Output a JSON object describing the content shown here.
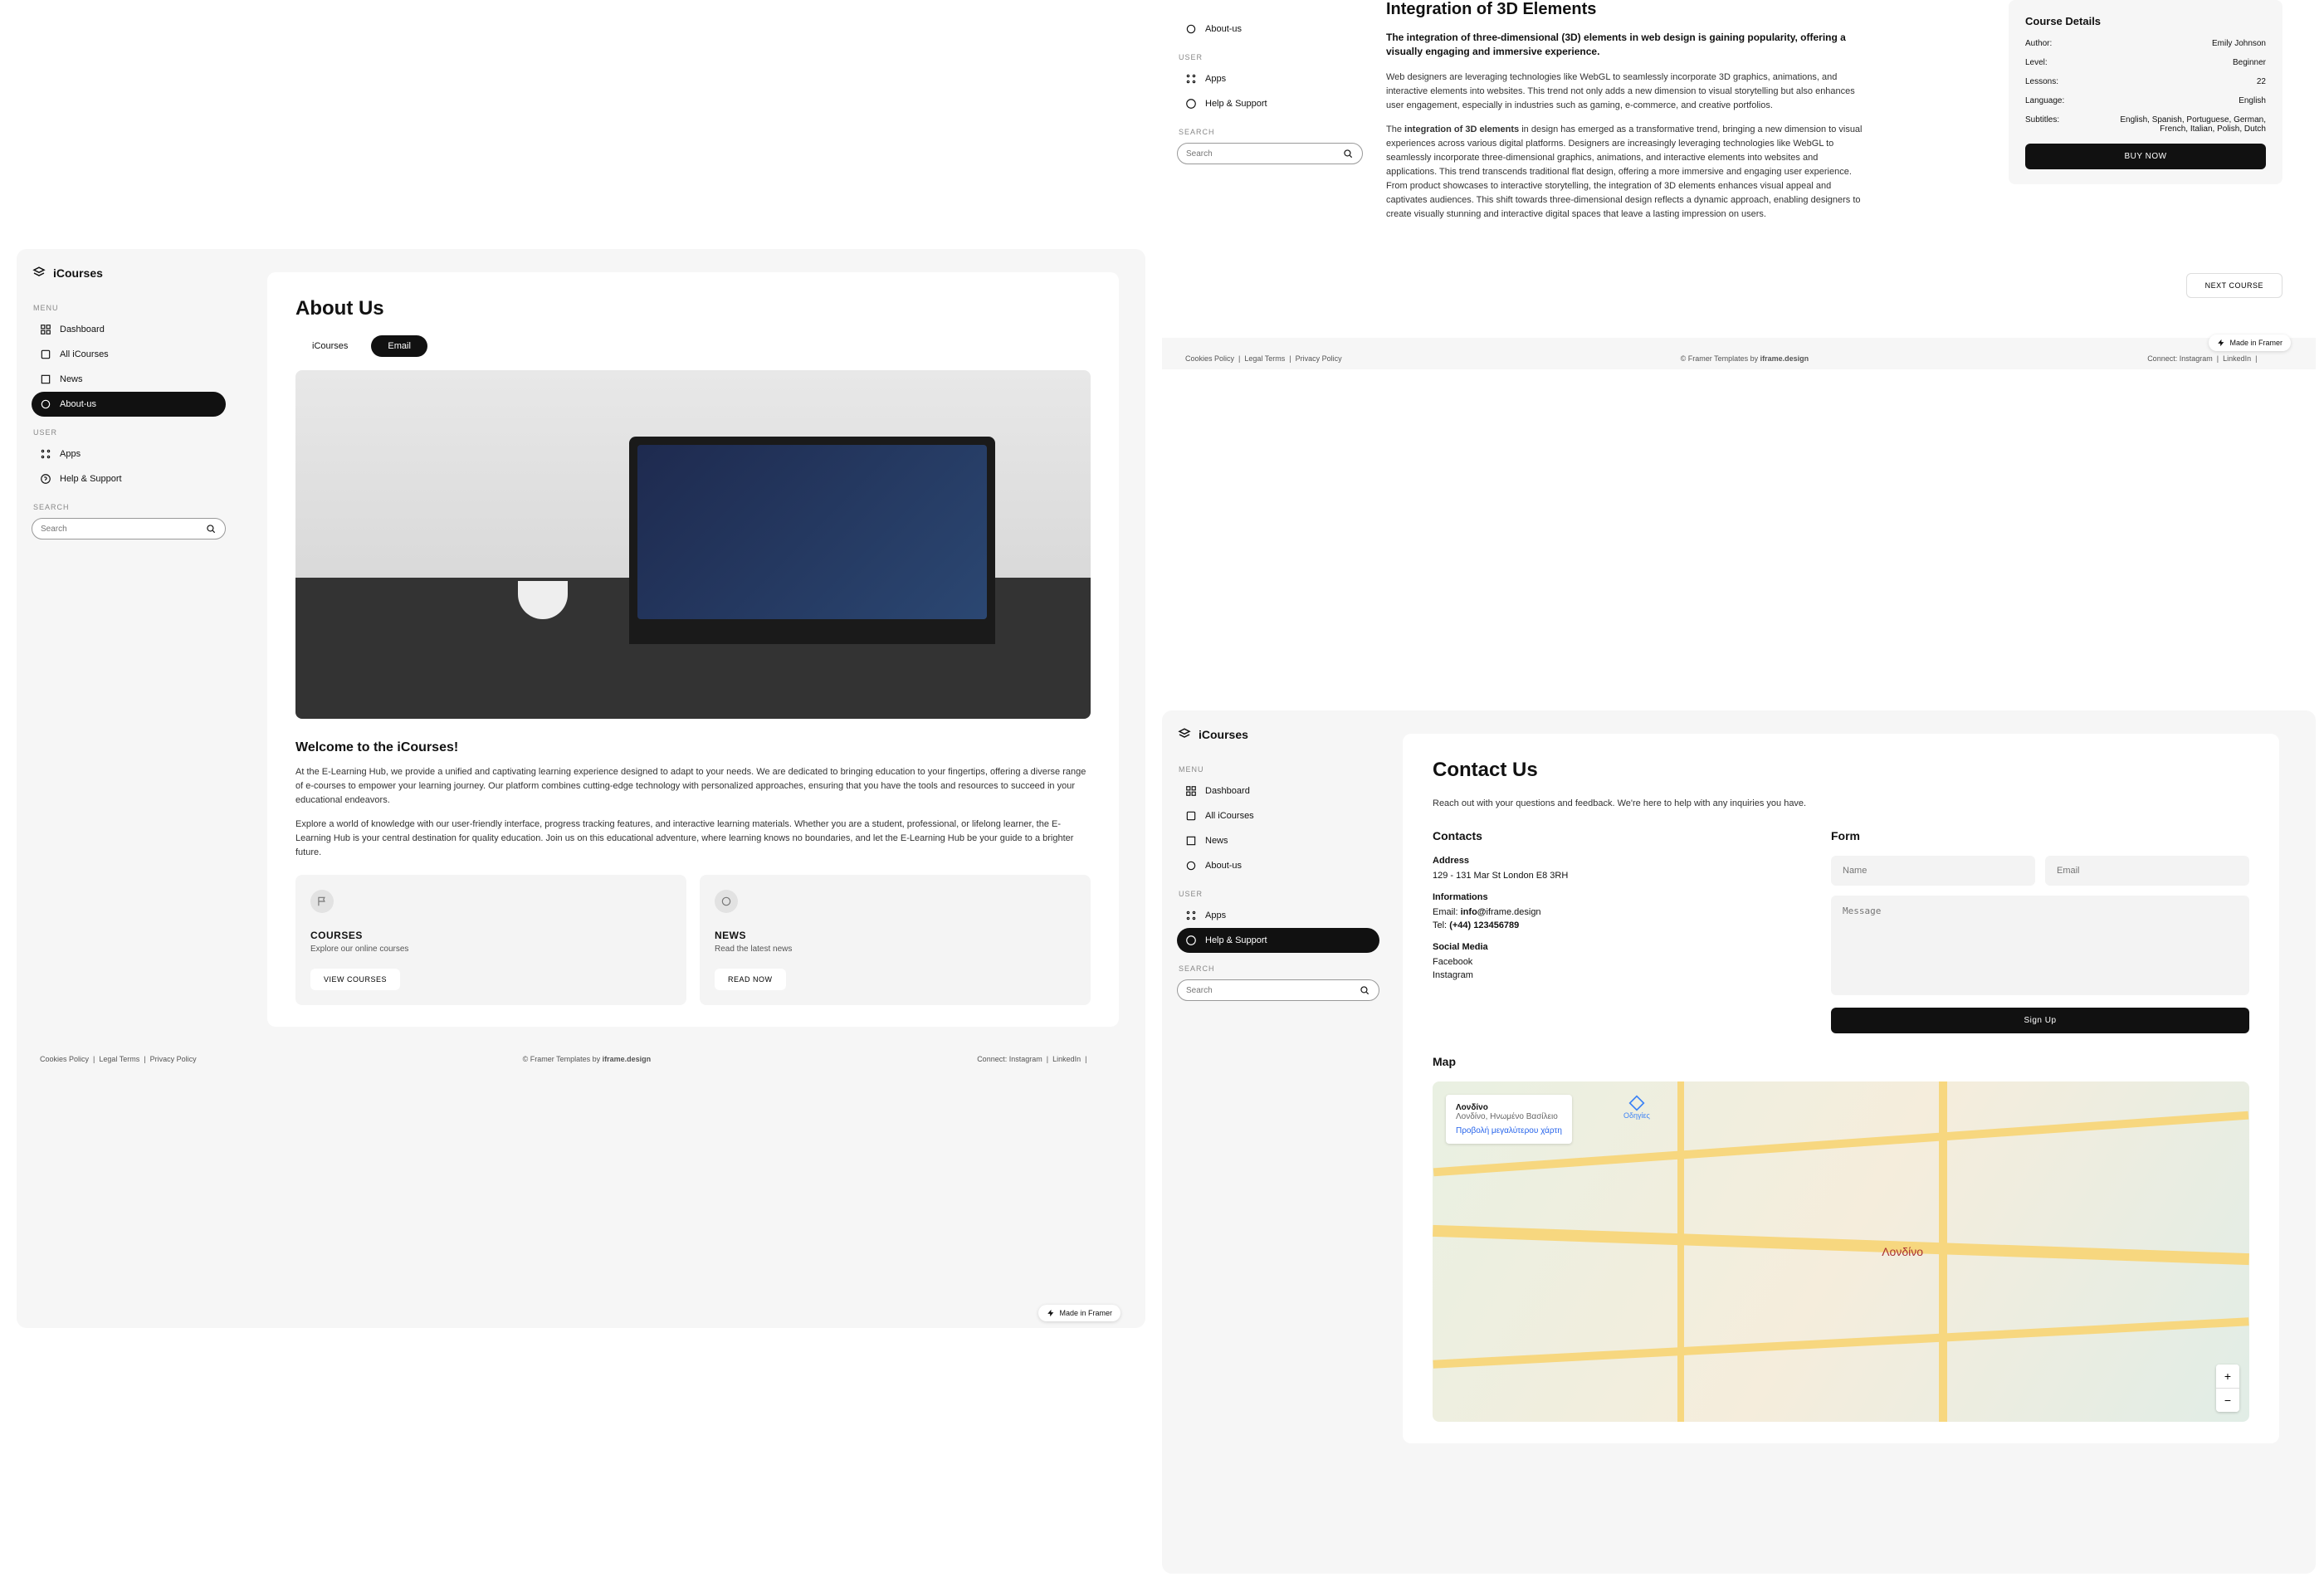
{
  "brand": "iCourses",
  "sidebar": {
    "menu_label": "MENU",
    "user_label": "USER",
    "search_label": "SEARCH",
    "items": {
      "dashboard": "Dashboard",
      "all": "All iCourses",
      "news": "News",
      "about": "About-us",
      "apps": "Apps",
      "help": "Help & Support"
    },
    "search_placeholder": "Search"
  },
  "about": {
    "title": "About Us",
    "tabs": {
      "icourses": "iCourses",
      "email": "Email"
    },
    "welcome": "Welcome to the iCourses!",
    "p1": "At the E-Learning Hub, we provide a unified and captivating learning experience designed to adapt to your needs. We are dedicated to bringing education to your fingertips, offering a diverse range of e-courses to empower your learning journey. Our platform combines cutting-edge technology with personalized approaches, ensuring that you have the tools and resources to succeed in your educational endeavors.",
    "p2": "Explore a world of knowledge with our user-friendly interface, progress tracking features, and interactive learning materials. Whether you are a student, professional, or lifelong learner, the E-Learning Hub is your central destination for quality education. Join us on this educational adventure, where learning knows no boundaries, and let the E-Learning Hub be your guide to a brighter future.",
    "card_courses": {
      "title": "COURSES",
      "desc": "Explore our online courses",
      "btn": "VIEW COURSES"
    },
    "card_news": {
      "title": "NEWS",
      "desc": "Read the latest news",
      "btn": "READ NOW"
    }
  },
  "article": {
    "title": "Integration of 3D Elements",
    "sub": "The integration of three-dimensional (3D) elements in web design is gaining popularity, offering a visually engaging and immersive experience.",
    "p1": "Web designers are leveraging technologies like WebGL to seamlessly incorporate 3D graphics, animations, and interactive elements into websites. This trend not only adds a new dimension to visual storytelling but also enhances user engagement, especially in industries such as gaming, e-commerce, and creative portfolios.",
    "p2a": "The ",
    "p2b": "integration of 3D elements",
    "p2c": " in design has emerged as a transformative trend, bringing a new dimension to visual experiences across various digital platforms. Designers are increasingly leveraging technologies like WebGL to seamlessly incorporate three-dimensional graphics, animations, and interactive elements into websites and applications. This trend transcends traditional flat design, offering a more immersive and engaging user experience. From product showcases to interactive storytelling, the integration of 3D elements enhances visual appeal and captivates audiences. This shift towards three-dimensional design reflects a dynamic approach, enabling designers to create visually stunning and interactive digital spaces that leave a lasting impression on users.",
    "next_btn": "NEXT COURSE"
  },
  "details": {
    "title": "Course Details",
    "author_l": "Author:",
    "author_v": "Emily Johnson",
    "level_l": "Level:",
    "level_v": "Beginner",
    "lessons_l": "Lessons:",
    "lessons_v": "22",
    "lang_l": "Language:",
    "lang_v": "English",
    "sub_l": "Subtitles:",
    "sub_v": "English, Spanish, Portuguese, German, French, Italian, Polish, Dutch",
    "buy": "BUY NOW"
  },
  "contact": {
    "title": "Contact Us",
    "subtitle": "Reach out with your questions and feedback. We're here to help with any inquiries you have.",
    "contacts_h": "Contacts",
    "form_h": "Form",
    "address_h": "Address",
    "address": "129 - 131 Mar St London E8 3RH",
    "info_h": "Informations",
    "email_l": "Email: ",
    "email_v": "info@",
    "email_d": "iframe.design",
    "tel_l": "Tel: ",
    "tel_v": "(+44) 123456789",
    "social_h": "Social Media",
    "facebook": "Facebook",
    "instagram": "Instagram",
    "name_ph": "Name",
    "email_ph": "Email",
    "msg_ph": "Message",
    "signup": "Sign Up",
    "map_h": "Map",
    "map_place": "Λονδίνο",
    "map_sub": "Λονδίνο, Ηνωμένο Βασίλειο",
    "map_bigger": "Προβολή μεγαλύτερου χάρτη",
    "map_dir": "Οδηγίες"
  },
  "footer": {
    "cookies": "Cookies Policy",
    "legal": "Legal Terms",
    "privacy": "Privacy Policy",
    "templates": "© Framer Templates by ",
    "templates_link": "iframe.design",
    "connect": "Connect: ",
    "instagram": "Instagram",
    "linkedin": "LinkedIn",
    "framer": "Made in Framer"
  }
}
